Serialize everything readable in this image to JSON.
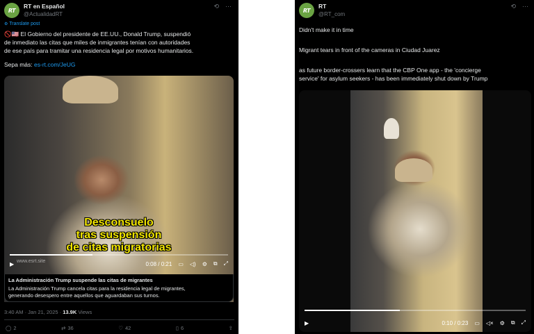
{
  "left": {
    "display_name": "RT en Español",
    "handle": "@ActualidadRT",
    "avatar_text": "RT",
    "translate_label": "Translate post",
    "text_lines": [
      "🚫🇺🇸 El Gobierno del presidente de EE.UU., Donald Trump, suspendió",
      "de inmediato las citas que miles de inmigrantes tenían con autoridades",
      "de ese país para tramitar una residencia legal por motivos humanitarios."
    ],
    "see_more_prefix": "Sepa más:",
    "link_text": "es-rt.com/JeUG",
    "video": {
      "caption_lines": [
        "Desconsuelo",
        "tras suspensión",
        "de citas migratorias"
      ],
      "watermark": "www.esrt.site",
      "time": "0:08 / 0:21",
      "progress": 0.38
    },
    "card_title": "La Administración Trump suspende las citas de migrantes",
    "card_desc_lines": [
      "La Administración Trump cancela citas para la residencia legal de migrantes,",
      "generando desespero entre aquellos que aguardaban sus turnos."
    ],
    "timestamp": "3:40 AM · Jan 21, 2025 · ",
    "views_count": "13.9K",
    "views_label": " Views",
    "actions": {
      "replies": "2",
      "reposts": "36",
      "likes": "42",
      "views": "6"
    }
  },
  "right": {
    "display_name": "RT",
    "handle": "@RT_com",
    "avatar_text": "RT",
    "text_lines": [
      "Didn't make it in time",
      "Migrant tears in front of the cameras in Ciudad Juarez",
      "as future border-crossers learn that the CBP One app - the 'concierge",
      "service' for asylum seekers - has been immediately shut down by Trump"
    ],
    "video": {
      "time": "0:10 / 0:23",
      "progress": 0.43
    }
  },
  "icons": {
    "grok": "grok-icon",
    "more": "more-icon",
    "play": "play-icon",
    "cc": "captions-icon",
    "volume": "volume-icon",
    "settings": "settings-icon",
    "pip": "pip-icon",
    "fullscreen": "fullscreen-icon"
  }
}
